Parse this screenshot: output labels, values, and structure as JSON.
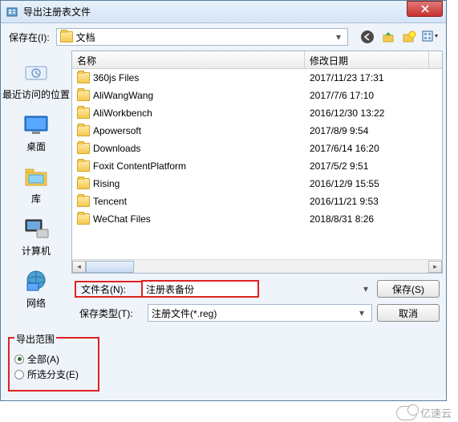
{
  "titlebar": {
    "title": "导出注册表文件"
  },
  "toolbar": {
    "save_in_label": "保存在(I):",
    "save_in_value": "文档"
  },
  "sidebar": {
    "items": [
      {
        "label": "最近访问的位置"
      },
      {
        "label": "桌面"
      },
      {
        "label": "库"
      },
      {
        "label": "计算机"
      },
      {
        "label": "网络"
      }
    ]
  },
  "list": {
    "headers": {
      "name": "名称",
      "date": "修改日期"
    },
    "rows": [
      {
        "name": "360js Files",
        "date": "2017/11/23 17:31"
      },
      {
        "name": "AliWangWang",
        "date": "2017/7/6 17:10"
      },
      {
        "name": "AliWorkbench",
        "date": "2016/12/30 13:22"
      },
      {
        "name": "Apowersoft",
        "date": "2017/8/9 9:54"
      },
      {
        "name": "Downloads",
        "date": "2017/6/14 16:20"
      },
      {
        "name": "Foxit ContentPlatform",
        "date": "2017/5/2 9:51"
      },
      {
        "name": "Rising",
        "date": "2016/12/9 15:55"
      },
      {
        "name": "Tencent",
        "date": "2016/11/21 9:53"
      },
      {
        "name": "WeChat Files",
        "date": "2018/8/31 8:26"
      }
    ]
  },
  "form": {
    "filename_label": "文件名(N):",
    "filename_value": "注册表备份",
    "filetype_label": "保存类型(T):",
    "filetype_value": "注册文件(*.reg)",
    "save_btn": "保存(S)",
    "cancel_btn": "取消"
  },
  "export": {
    "group_title": "导出范围",
    "all_label": "全部(A)",
    "selected_label": "所选分支(E)"
  },
  "watermark": {
    "text": "亿速云"
  }
}
